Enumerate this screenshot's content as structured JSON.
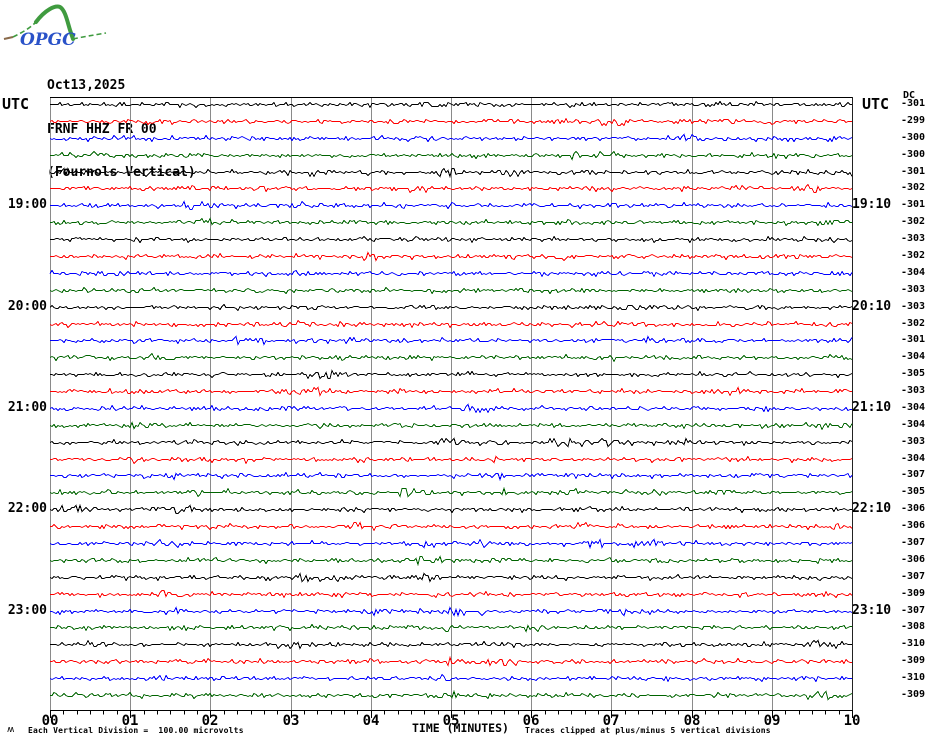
{
  "logo": {
    "text": "OPGC",
    "curve_color": "#3f9b3f",
    "text_color": "#2a52c8"
  },
  "title": {
    "date": "Oct13,2025",
    "station": "FRNF HHZ FR 00",
    "component": "(Fournols Vertical)"
  },
  "left_axis": {
    "header": "UTC",
    "hour_labels": [
      "19:00",
      "20:00",
      "21:00",
      "22:00",
      "23:00"
    ]
  },
  "right_axis": {
    "header": "UTC",
    "dc_header": "DC",
    "hour_labels": [
      "19:10",
      "20:10",
      "21:10",
      "22:10",
      "23:10"
    ]
  },
  "x_axis": {
    "tick_labels": [
      "00",
      "01",
      "02",
      "03",
      "04",
      "05",
      "06",
      "07",
      "08",
      "09",
      "10"
    ],
    "title": "TIME (MINUTES)"
  },
  "footer": {
    "corner_glyph": "ʍ",
    "scale_note": "Each Vertical Division =  100.00 microvolts",
    "clip_note": "Traces clipped at plus/minus 5 vertical divisions"
  },
  "chart_data": {
    "type": "line",
    "title": "FRNF HHZ FR 00 (Fournols Vertical) helicorder drum plot, Oct13,2025",
    "xlabel": "TIME (MINUTES)",
    "x_range_minutes": [
      0,
      10
    ],
    "x_minor_ticks_per_minute": 6,
    "minutes_per_trace": 10,
    "trace_count": 36,
    "first_trace_start_utc": "18:00",
    "last_trace_end_utc": "00:00",
    "hour_label_rows": [
      6,
      12,
      18,
      24,
      30
    ],
    "trace_color_cycle": [
      "#000000",
      "#ff0000",
      "#0000ff",
      "#006400"
    ],
    "grid_color": "#8a8a8a",
    "microvolts_per_division": 100.0,
    "clip_divisions": 5,
    "noise_peak_to_peak_divisions": 0.2,
    "dc_offsets_microvolts": [
      -301,
      -299,
      -300,
      -300,
      -301,
      -302,
      -301,
      -302,
      -303,
      -302,
      -304,
      -303,
      -303,
      -302,
      -301,
      -304,
      -305,
      -303,
      -304,
      -304,
      -303,
      -304,
      -307,
      -305,
      -306,
      -306,
      -307,
      -306,
      -307,
      -309,
      -307,
      -308,
      -310,
      -309,
      -310,
      -309
    ]
  }
}
